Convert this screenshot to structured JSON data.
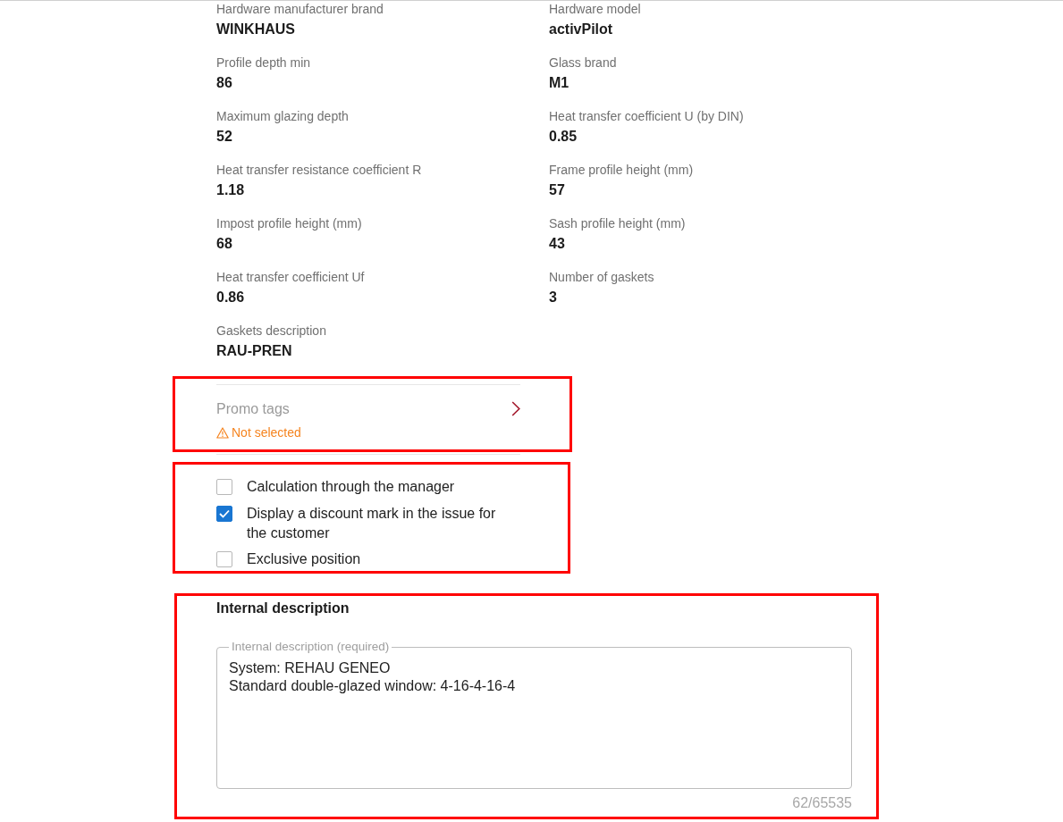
{
  "specs": [
    {
      "label": "Hardware manufacturer brand",
      "value": "WINKHAUS"
    },
    {
      "label": "Hardware model",
      "value": "activPilot"
    },
    {
      "label": "Profile depth min",
      "value": "86"
    },
    {
      "label": "Glass brand",
      "value": "M1"
    },
    {
      "label": "Maximum glazing depth",
      "value": "52"
    },
    {
      "label": "Heat transfer coefficient U (by DIN)",
      "value": "0.85"
    },
    {
      "label": "Heat transfer resistance coefficient R",
      "value": "1.18"
    },
    {
      "label": "Frame profile height (mm)",
      "value": "57"
    },
    {
      "label": "Impost profile height (mm)",
      "value": "68"
    },
    {
      "label": "Sash profile height (mm)",
      "value": "43"
    },
    {
      "label": "Heat transfer coefficient Uf",
      "value": "0.86"
    },
    {
      "label": "Number of gaskets",
      "value": "3"
    },
    {
      "label": "Gaskets description",
      "value": "RAU-PREN"
    }
  ],
  "promo": {
    "highlighted": true,
    "label": "Promo tags",
    "status": "Not selected",
    "warning": true
  },
  "options": {
    "highlighted": true,
    "items": [
      {
        "label": "Calculation through the manager",
        "checked": false
      },
      {
        "label": "Display a discount mark in the issue for the customer",
        "checked": true
      },
      {
        "label": "Exclusive position",
        "checked": false
      }
    ]
  },
  "internal_description": {
    "highlighted": true,
    "heading": "Internal description",
    "field": {
      "label": "Internal description (required)",
      "value": "System: REHAU GENEO\nStandard double-glazed window: 4-16-4-16-4"
    },
    "counter": "62/65535"
  }
}
